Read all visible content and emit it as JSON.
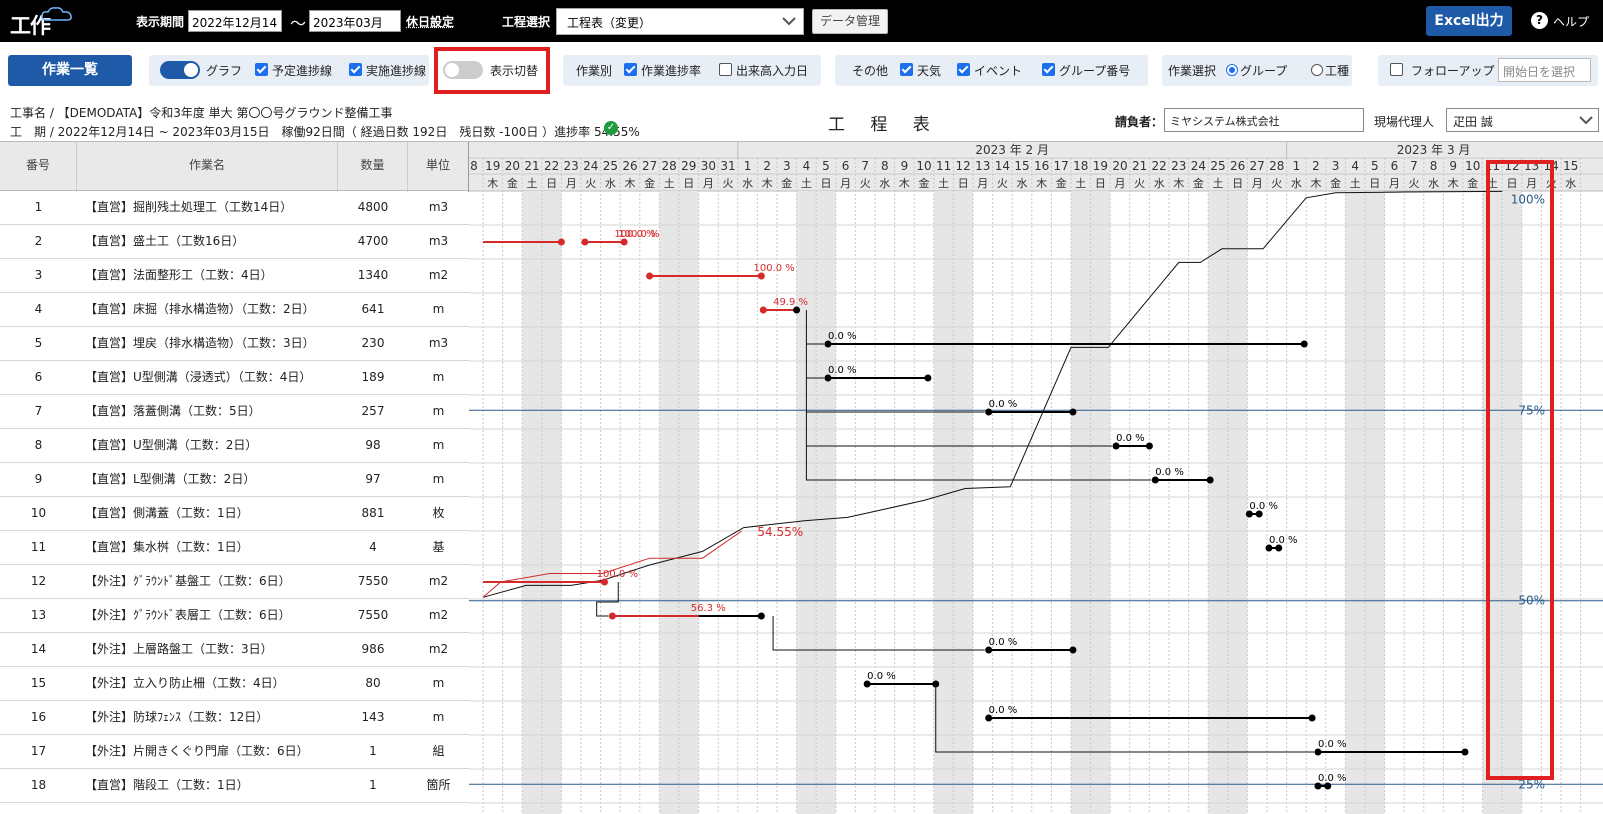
{
  "topbar": {
    "logo_text": "工作",
    "period_label": "表示期間",
    "period_start": "2022年12月14日",
    "period_tilde": "〜",
    "period_end": "2023年03月15日",
    "holiday_label": "休日設定",
    "process_select_label": "工程選択",
    "process_select_value": "工程表（変更）",
    "data_manage_label": "データ管理",
    "excel_label": "Excel出力",
    "help_label": "ヘルプ",
    "help_icon": "?"
  },
  "toolbar": {
    "work_list_label": "作業一覧",
    "graph_label": "グラフ",
    "planned_progress_label": "予定進捗線",
    "actual_progress_label": "実施進捗線",
    "display_switch_label": "表示切替",
    "by_work_label": "作業別",
    "work_progress_label": "作業進捗率",
    "output_input_label": "出来高入力日",
    "other_label": "その他",
    "weather_label": "天気",
    "event_label": "イベント",
    "group_no_label": "グループ番号",
    "work_select_label": "作業選択",
    "group_label": "グループ",
    "kind_label": "工種",
    "follow_up_label": "フォローアップ",
    "start_date_placeholder": "開始日を選択"
  },
  "project": {
    "name_line": "工事名 / 【DEMODATA】令和3年度 単大 第〇〇号グラウンド整備工事",
    "period_line": "工　期 / 2022年12月14日 ~ 2023年03月15日　稼働92日間（ 経過日数 192日　残日数 -100日 ）進捗率 54.55%",
    "ok_icon": "✓",
    "chart_title": "工 程 表",
    "contractor_label": "請負者：",
    "contractor_value": "ミヤシステム株式会社",
    "agent_label": "現場代理人",
    "agent_value": "疋田 誠"
  },
  "table": {
    "headers": [
      "番号",
      "作業名",
      "数量",
      "単位"
    ],
    "rows": [
      {
        "no": "1",
        "name": "【直営】掘削残土処理工（工数14日）",
        "qty": "4800",
        "unit": "m3"
      },
      {
        "no": "2",
        "name": "【直営】盛土工（工数16日）",
        "qty": "4700",
        "unit": "m3"
      },
      {
        "no": "3",
        "name": "【直営】法面整形工（工数：4日）",
        "qty": "1340",
        "unit": "m2"
      },
      {
        "no": "4",
        "name": "【直営】床掘（排水構造物）（工数：2日）",
        "qty": "641",
        "unit": "m"
      },
      {
        "no": "5",
        "name": "【直営】埋戻（排水構造物）（工数：3日）",
        "qty": "230",
        "unit": "m3"
      },
      {
        "no": "6",
        "name": "【直営】U型側溝（浸透式）（工数：4日）",
        "qty": "189",
        "unit": "m"
      },
      {
        "no": "7",
        "name": "【直営】落蓋側溝（工数：5日）",
        "qty": "257",
        "unit": "m"
      },
      {
        "no": "8",
        "name": "【直営】U型側溝（工数：2日）",
        "qty": "98",
        "unit": "m"
      },
      {
        "no": "9",
        "name": "【直営】L型側溝（工数：2日）",
        "qty": "97",
        "unit": "m"
      },
      {
        "no": "10",
        "name": "【直営】側溝蓋（工数：1日）",
        "qty": "881",
        "unit": "枚"
      },
      {
        "no": "11",
        "name": "【直営】集水桝（工数：1日）",
        "qty": "4",
        "unit": "基"
      },
      {
        "no": "12",
        "name": "【外注】ｸﾞﾗｳﾝﾄﾞ基盤工（工数：6日）",
        "qty": "7550",
        "unit": "m2"
      },
      {
        "no": "13",
        "name": "【外注】ｸﾞﾗｳﾝﾄﾞ表層工（工数：6日）",
        "qty": "7550",
        "unit": "m2"
      },
      {
        "no": "14",
        "name": "【外注】上層路盤工（工数：3日）",
        "qty": "986",
        "unit": "m2"
      },
      {
        "no": "15",
        "name": "【外注】立入り防止柵（工数：4日）",
        "qty": "80",
        "unit": "m"
      },
      {
        "no": "16",
        "name": "【外注】防球ﾌｪﾝｽ（工数：12日）",
        "qty": "143",
        "unit": "m"
      },
      {
        "no": "17",
        "name": "【外注】片開きくぐり門扉（工数：6日）",
        "qty": "1",
        "unit": "組"
      },
      {
        "no": "18",
        "name": "【直営】階段工（工数：1日）",
        "qty": "1",
        "unit": "箇所"
      }
    ]
  },
  "gantt": {
    "month_feb": "2023 年 2 月",
    "month_mar": "2023 年 3 月",
    "first_day_partial": "8",
    "days": [
      {
        "d": "19",
        "w": "木"
      },
      {
        "d": "20",
        "w": "金"
      },
      {
        "d": "21",
        "w": "土"
      },
      {
        "d": "22",
        "w": "日"
      },
      {
        "d": "23",
        "w": "月"
      },
      {
        "d": "24",
        "w": "火"
      },
      {
        "d": "25",
        "w": "水"
      },
      {
        "d": "26",
        "w": "木"
      },
      {
        "d": "27",
        "w": "金"
      },
      {
        "d": "28",
        "w": "土"
      },
      {
        "d": "29",
        "w": "日"
      },
      {
        "d": "30",
        "w": "月"
      },
      {
        "d": "31",
        "w": "火"
      },
      {
        "d": "1",
        "w": "水"
      },
      {
        "d": "2",
        "w": "木"
      },
      {
        "d": "3",
        "w": "金"
      },
      {
        "d": "4",
        "w": "土"
      },
      {
        "d": "5",
        "w": "日"
      },
      {
        "d": "6",
        "w": "月"
      },
      {
        "d": "7",
        "w": "火"
      },
      {
        "d": "8",
        "w": "水"
      },
      {
        "d": "9",
        "w": "木"
      },
      {
        "d": "10",
        "w": "金"
      },
      {
        "d": "11",
        "w": "土"
      },
      {
        "d": "12",
        "w": "日"
      },
      {
        "d": "13",
        "w": "月"
      },
      {
        "d": "14",
        "w": "火"
      },
      {
        "d": "15",
        "w": "水"
      },
      {
        "d": "16",
        "w": "木"
      },
      {
        "d": "17",
        "w": "金"
      },
      {
        "d": "18",
        "w": "土"
      },
      {
        "d": "19",
        "w": "日"
      },
      {
        "d": "20",
        "w": "月"
      },
      {
        "d": "21",
        "w": "火"
      },
      {
        "d": "22",
        "w": "水"
      },
      {
        "d": "23",
        "w": "木"
      },
      {
        "d": "24",
        "w": "金"
      },
      {
        "d": "25",
        "w": "土"
      },
      {
        "d": "26",
        "w": "日"
      },
      {
        "d": "27",
        "w": "月"
      },
      {
        "d": "28",
        "w": "火"
      },
      {
        "d": "1",
        "w": "水"
      },
      {
        "d": "2",
        "w": "木"
      },
      {
        "d": "3",
        "w": "金"
      },
      {
        "d": "4",
        "w": "土"
      },
      {
        "d": "5",
        "w": "日"
      },
      {
        "d": "6",
        "w": "月"
      },
      {
        "d": "7",
        "w": "火"
      },
      {
        "d": "8",
        "w": "水"
      },
      {
        "d": "9",
        "w": "木"
      },
      {
        "d": "10",
        "w": "金"
      },
      {
        "d": "11",
        "w": "土"
      },
      {
        "d": "12",
        "w": "日"
      },
      {
        "d": "13",
        "w": "月"
      },
      {
        "d": "14",
        "w": "火"
      },
      {
        "d": "15",
        "w": "水"
      }
    ],
    "progress_labels": {
      "p100": "100%",
      "p75": "75%",
      "p50": "50%",
      "p25": "25%"
    },
    "actual_progress_label": "54.55%",
    "bar_labels": [
      {
        "text": "100.0 %",
        "color": "#d62a2a"
      },
      {
        "text": "100.0 %",
        "color": "#d62a2a"
      },
      {
        "text": "100.0 %",
        "color": "#d62a2a"
      },
      {
        "text": "49.9 %",
        "color": "#d62a2a"
      },
      {
        "text": "0.0 %",
        "color": "#000"
      },
      {
        "text": "0.0 %",
        "color": "#000"
      },
      {
        "text": "0.0 %",
        "color": "#000"
      },
      {
        "text": "0.0 %",
        "color": "#000"
      },
      {
        "text": "0.0 %",
        "color": "#000"
      },
      {
        "text": "0.0 %",
        "color": "#000"
      },
      {
        "text": "0.0 %",
        "color": "#000"
      },
      {
        "text": "100.0 %",
        "color": "#d62a2a"
      },
      {
        "text": "56.3 %",
        "color": "#d62a2a"
      },
      {
        "text": "0.0 %",
        "color": "#000"
      },
      {
        "text": "0.0 %",
        "color": "#000"
      },
      {
        "text": "0.0 %",
        "color": "#000"
      },
      {
        "text": "0.0 %",
        "color": "#000"
      },
      {
        "text": "0.0 %",
        "color": "#000"
      }
    ]
  },
  "colors": {
    "accent": "#1e5aa8",
    "done": "#d62a2a",
    "pending": "#000000",
    "highlight": "#e02020",
    "weekend": "#e6e6e6"
  }
}
